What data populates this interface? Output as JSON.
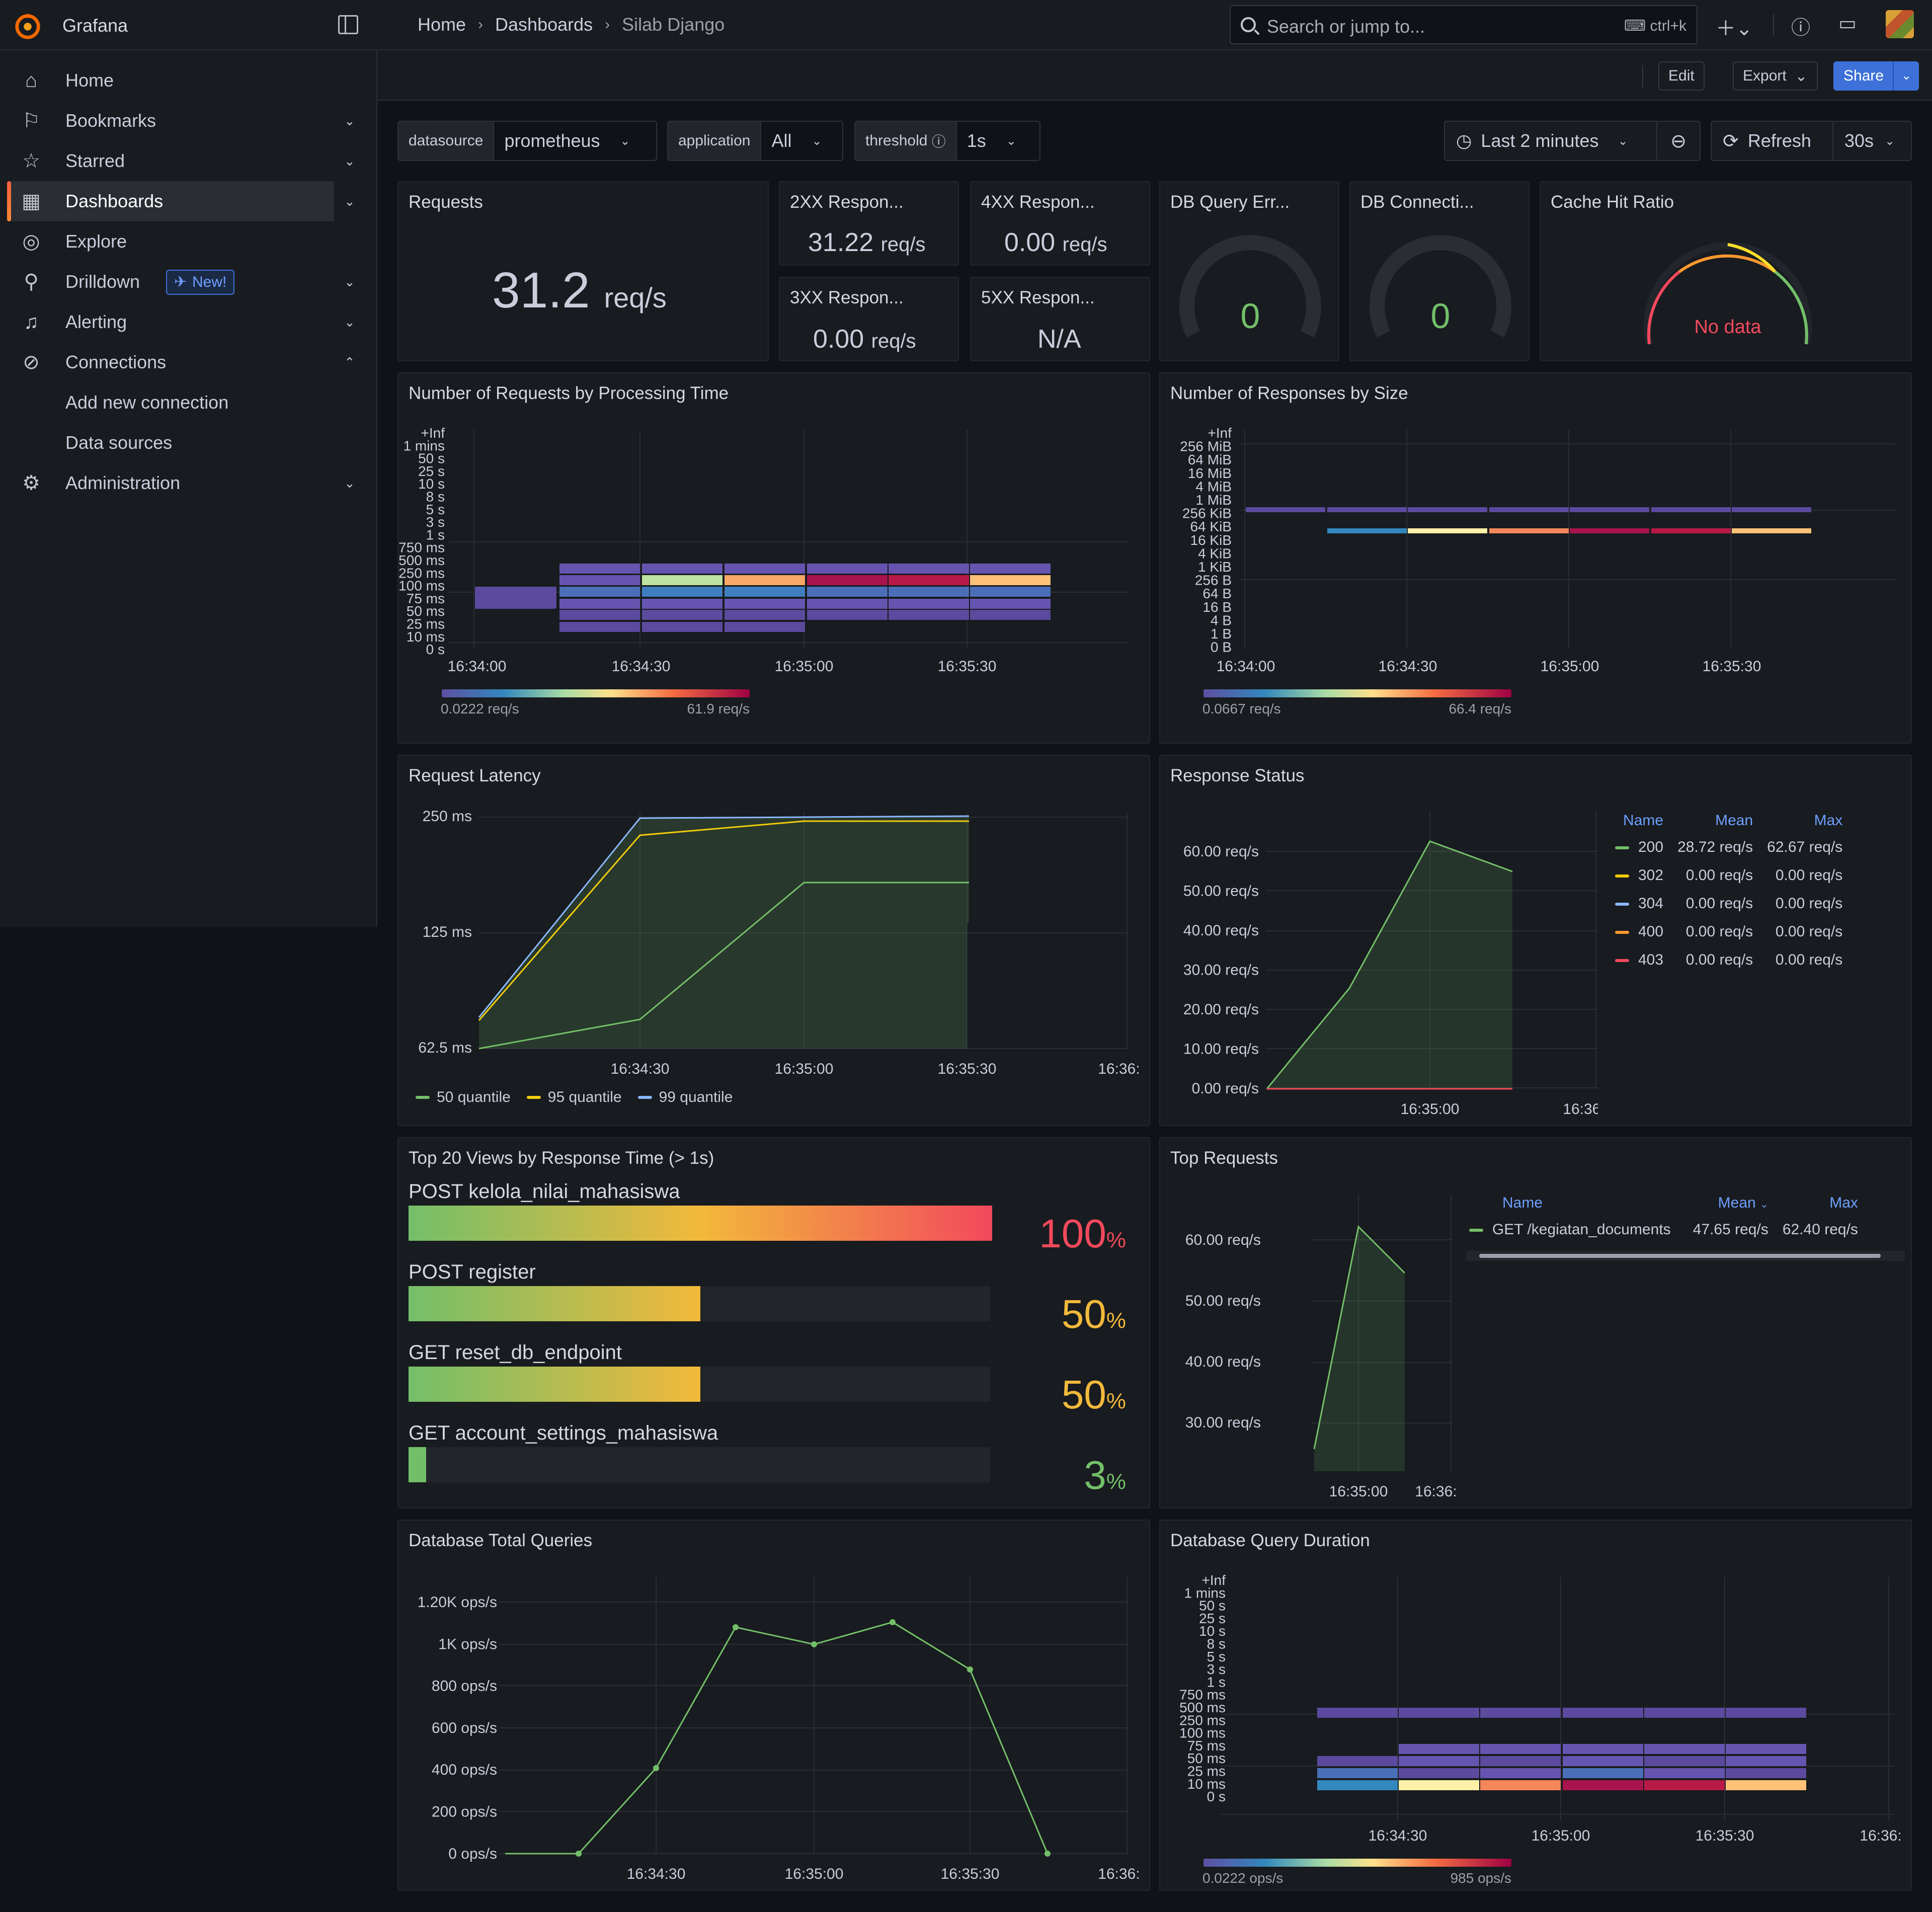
{
  "app": {
    "brand": "Grafana"
  },
  "breadcrumb": [
    "Home",
    "Dashboards",
    "Silab Django"
  ],
  "search": {
    "placeholder": "Search or jump to...",
    "shortcut": "ctrl+k"
  },
  "toolbar": {
    "edit": "Edit",
    "export": "Export",
    "share": "Share"
  },
  "sidebar": {
    "items": [
      {
        "label": "Home",
        "icon": "home-icon"
      },
      {
        "label": "Bookmarks",
        "icon": "bookmark-icon"
      },
      {
        "label": "Starred",
        "icon": "star-icon"
      },
      {
        "label": "Dashboards",
        "icon": "apps-icon"
      },
      {
        "label": "Explore",
        "icon": "compass-icon"
      },
      {
        "label": "Drilldown",
        "icon": "drilldown-icon",
        "badge": "New!"
      },
      {
        "label": "Alerting",
        "icon": "bell-icon"
      },
      {
        "label": "Connections",
        "icon": "connections-icon"
      },
      {
        "label": "Add new connection"
      },
      {
        "label": "Data sources"
      },
      {
        "label": "Administration",
        "icon": "cog-icon"
      }
    ]
  },
  "variables": {
    "datasource": {
      "label": "datasource",
      "value": "prometheus"
    },
    "application": {
      "label": "application",
      "value": "All"
    },
    "threshold": {
      "label": "threshold",
      "value": "1s"
    }
  },
  "time": {
    "range": "Last 2 minutes",
    "refresh": "Refresh",
    "interval": "30s"
  },
  "colors": {
    "accent": "#3d71d9",
    "green": "#73bf69",
    "yellow": "#f2cc0c",
    "blue": "#8ab8ff",
    "orange": "#ff9830",
    "red": "#f2495c"
  },
  "panels": {
    "requests": {
      "title": "Requests",
      "value": "31.2",
      "unit": "req/s"
    },
    "r2xx": {
      "title": "2XX Respon...",
      "value": "31.22",
      "unit": "req/s"
    },
    "r4xx": {
      "title": "4XX Respon...",
      "value": "0.00",
      "unit": "req/s"
    },
    "r3xx": {
      "title": "3XX Respon...",
      "value": "0.00",
      "unit": "req/s"
    },
    "r5xx": {
      "title": "5XX Respon...",
      "value": "N/A"
    },
    "dberr": {
      "title": "DB Query Err...",
      "value": "0"
    },
    "dbconn": {
      "title": "DB Connecti...",
      "value": "0"
    },
    "cache": {
      "title": "Cache Hit Ratio",
      "value": "No data"
    },
    "proc_time": {
      "title": "Number of Requests by Processing Time",
      "ylabels": [
        "+Inf",
        "1 mins",
        "50 s",
        "25 s",
        "10 s",
        "8 s",
        "5 s",
        "3 s",
        "1 s",
        "750 ms",
        "500 ms",
        "250 ms",
        "100 ms",
        "75 ms",
        "50 ms",
        "25 ms",
        "10 ms",
        "0 s"
      ],
      "xlabels": [
        "16:34:00",
        "16:34:30",
        "16:35:00",
        "16:35:30"
      ],
      "scale_min": "0.0222 req/s",
      "scale_max": "61.9 req/s"
    },
    "resp_size": {
      "title": "Number of Responses by Size",
      "ylabels": [
        "+Inf",
        "256 MiB",
        "64 MiB",
        "16 MiB",
        "4 MiB",
        "1 MiB",
        "256 KiB",
        "64 KiB",
        "16 KiB",
        "4 KiB",
        "1 KiB",
        "256 B",
        "64 B",
        "16 B",
        "4 B",
        "1 B",
        "0 B"
      ],
      "xlabels": [
        "16:34:00",
        "16:34:30",
        "16:35:00",
        "16:35:30"
      ],
      "scale_min": "0.0667 req/s",
      "scale_max": "66.4 req/s"
    },
    "latency": {
      "title": "Request Latency",
      "ylabels": [
        "250 ms",
        "125 ms",
        "62.5 ms"
      ],
      "xlabels": [
        "16:34:30",
        "16:35:00",
        "16:35:30",
        "16:36:"
      ],
      "legend": [
        "50 quantile",
        "95 quantile",
        "99 quantile"
      ]
    },
    "status": {
      "title": "Response Status",
      "ylabels": [
        "60.00 req/s",
        "50.00 req/s",
        "40.00 req/s",
        "30.00 req/s",
        "20.00 req/s",
        "10.00 req/s",
        "0.00 req/s"
      ],
      "xlabels": [
        "16:35:00",
        "16:36:"
      ],
      "headers": [
        "Name",
        "Mean",
        "Max"
      ],
      "rows": [
        {
          "name": "200",
          "mean": "28.72 req/s",
          "max": "62.67 req/s",
          "color": "#73bf69"
        },
        {
          "name": "302",
          "mean": "0.00 req/s",
          "max": "0.00 req/s",
          "color": "#f2cc0c"
        },
        {
          "name": "304",
          "mean": "0.00 req/s",
          "max": "0.00 req/s",
          "color": "#8ab8ff"
        },
        {
          "name": "400",
          "mean": "0.00 req/s",
          "max": "0.00 req/s",
          "color": "#ff9830"
        },
        {
          "name": "403",
          "mean": "0.00 req/s",
          "max": "0.00 req/s",
          "color": "#f2495c"
        }
      ]
    },
    "top_views": {
      "title": "Top 20 Views by Response Time (> 1s)",
      "items": [
        {
          "name": "POST kelola_nilai_mahasiswa",
          "pct": "100",
          "frac": 1.0,
          "color": "#f2495c"
        },
        {
          "name": "POST register",
          "pct": "50",
          "frac": 0.5,
          "color": "#f2b93b"
        },
        {
          "name": "GET reset_db_endpoint",
          "pct": "50",
          "frac": 0.5,
          "color": "#f2b93b"
        },
        {
          "name": "GET account_settings_mahasiswa",
          "pct": "3",
          "frac": 0.03,
          "color": "#73bf69"
        }
      ],
      "pct_unit": "%"
    },
    "top_requests": {
      "title": "Top Requests",
      "ylabels": [
        "60.00 req/s",
        "50.00 req/s",
        "40.00 req/s",
        "30.00 req/s"
      ],
      "xlabels": [
        "16:35:00",
        "16:36:"
      ],
      "headers": [
        "Name",
        "Mean",
        "Max"
      ],
      "rows": [
        {
          "name": "GET /kegiatan_documents",
          "mean": "47.65 req/s",
          "max": "62.40 req/s",
          "color": "#73bf69"
        }
      ]
    },
    "db_total": {
      "title": "Database Total Queries",
      "ylabels": [
        "1.20K ops/s",
        "1K ops/s",
        "800 ops/s",
        "600 ops/s",
        "400 ops/s",
        "200 ops/s",
        "0 ops/s"
      ],
      "xlabels": [
        "16:34:30",
        "16:35:00",
        "16:35:30",
        "16:36:"
      ]
    },
    "db_duration": {
      "title": "Database Query Duration",
      "ylabels": [
        "+Inf",
        "1 mins",
        "50 s",
        "25 s",
        "10 s",
        "8 s",
        "5 s",
        "3 s",
        "1 s",
        "750 ms",
        "500 ms",
        "250 ms",
        "100 ms",
        "75 ms",
        "50 ms",
        "25 ms",
        "10 ms",
        "0 s"
      ],
      "xlabels": [
        "16:34:30",
        "16:35:00",
        "16:35:30",
        "16:36:"
      ],
      "scale_min": "0.0222 ops/s",
      "scale_max": "985 ops/s"
    }
  },
  "chart_data": [
    {
      "type": "line",
      "title": "Request Latency",
      "x": [
        "16:34:00",
        "16:34:30",
        "16:35:00",
        "16:35:30"
      ],
      "series": [
        {
          "name": "50 quantile",
          "values": [
            62.5,
            70,
            160,
            160
          ]
        },
        {
          "name": "95 quantile",
          "values": [
            70,
            235,
            245,
            245
          ]
        },
        {
          "name": "99 quantile",
          "values": [
            70,
            250,
            250,
            250
          ]
        }
      ]
    },
    {
      "type": "area",
      "title": "Response Status",
      "x": [
        "16:34:30",
        "16:34:45",
        "16:35:00",
        "16:35:30"
      ],
      "series": [
        {
          "name": "200",
          "values": [
            0,
            25,
            62.67,
            55
          ]
        },
        {
          "name": "302",
          "values": [
            0,
            0,
            0,
            0
          ]
        },
        {
          "name": "304",
          "values": [
            0,
            0,
            0,
            0
          ]
        },
        {
          "name": "400",
          "values": [
            0,
            0,
            0,
            0
          ]
        },
        {
          "name": "403",
          "values": [
            0,
            0,
            0,
            0
          ]
        }
      ]
    },
    {
      "type": "line",
      "title": "Database Total Queries",
      "x": [
        "16:34:15",
        "16:34:30",
        "16:34:45",
        "16:35:00",
        "16:35:15",
        "16:35:30",
        "16:35:45"
      ],
      "series": [
        {
          "values": [
            0,
            0,
            410,
            1080,
            1000,
            1110,
            880,
            0
          ]
        }
      ],
      "ylim": [
        0,
        1200
      ]
    },
    {
      "type": "area",
      "title": "Top Requests",
      "x": [
        "16:34:50",
        "16:35:00",
        "16:35:10"
      ],
      "series": [
        {
          "name": "GET /kegiatan_documents",
          "values": [
            27,
            62.4,
            55
          ]
        }
      ]
    }
  ]
}
